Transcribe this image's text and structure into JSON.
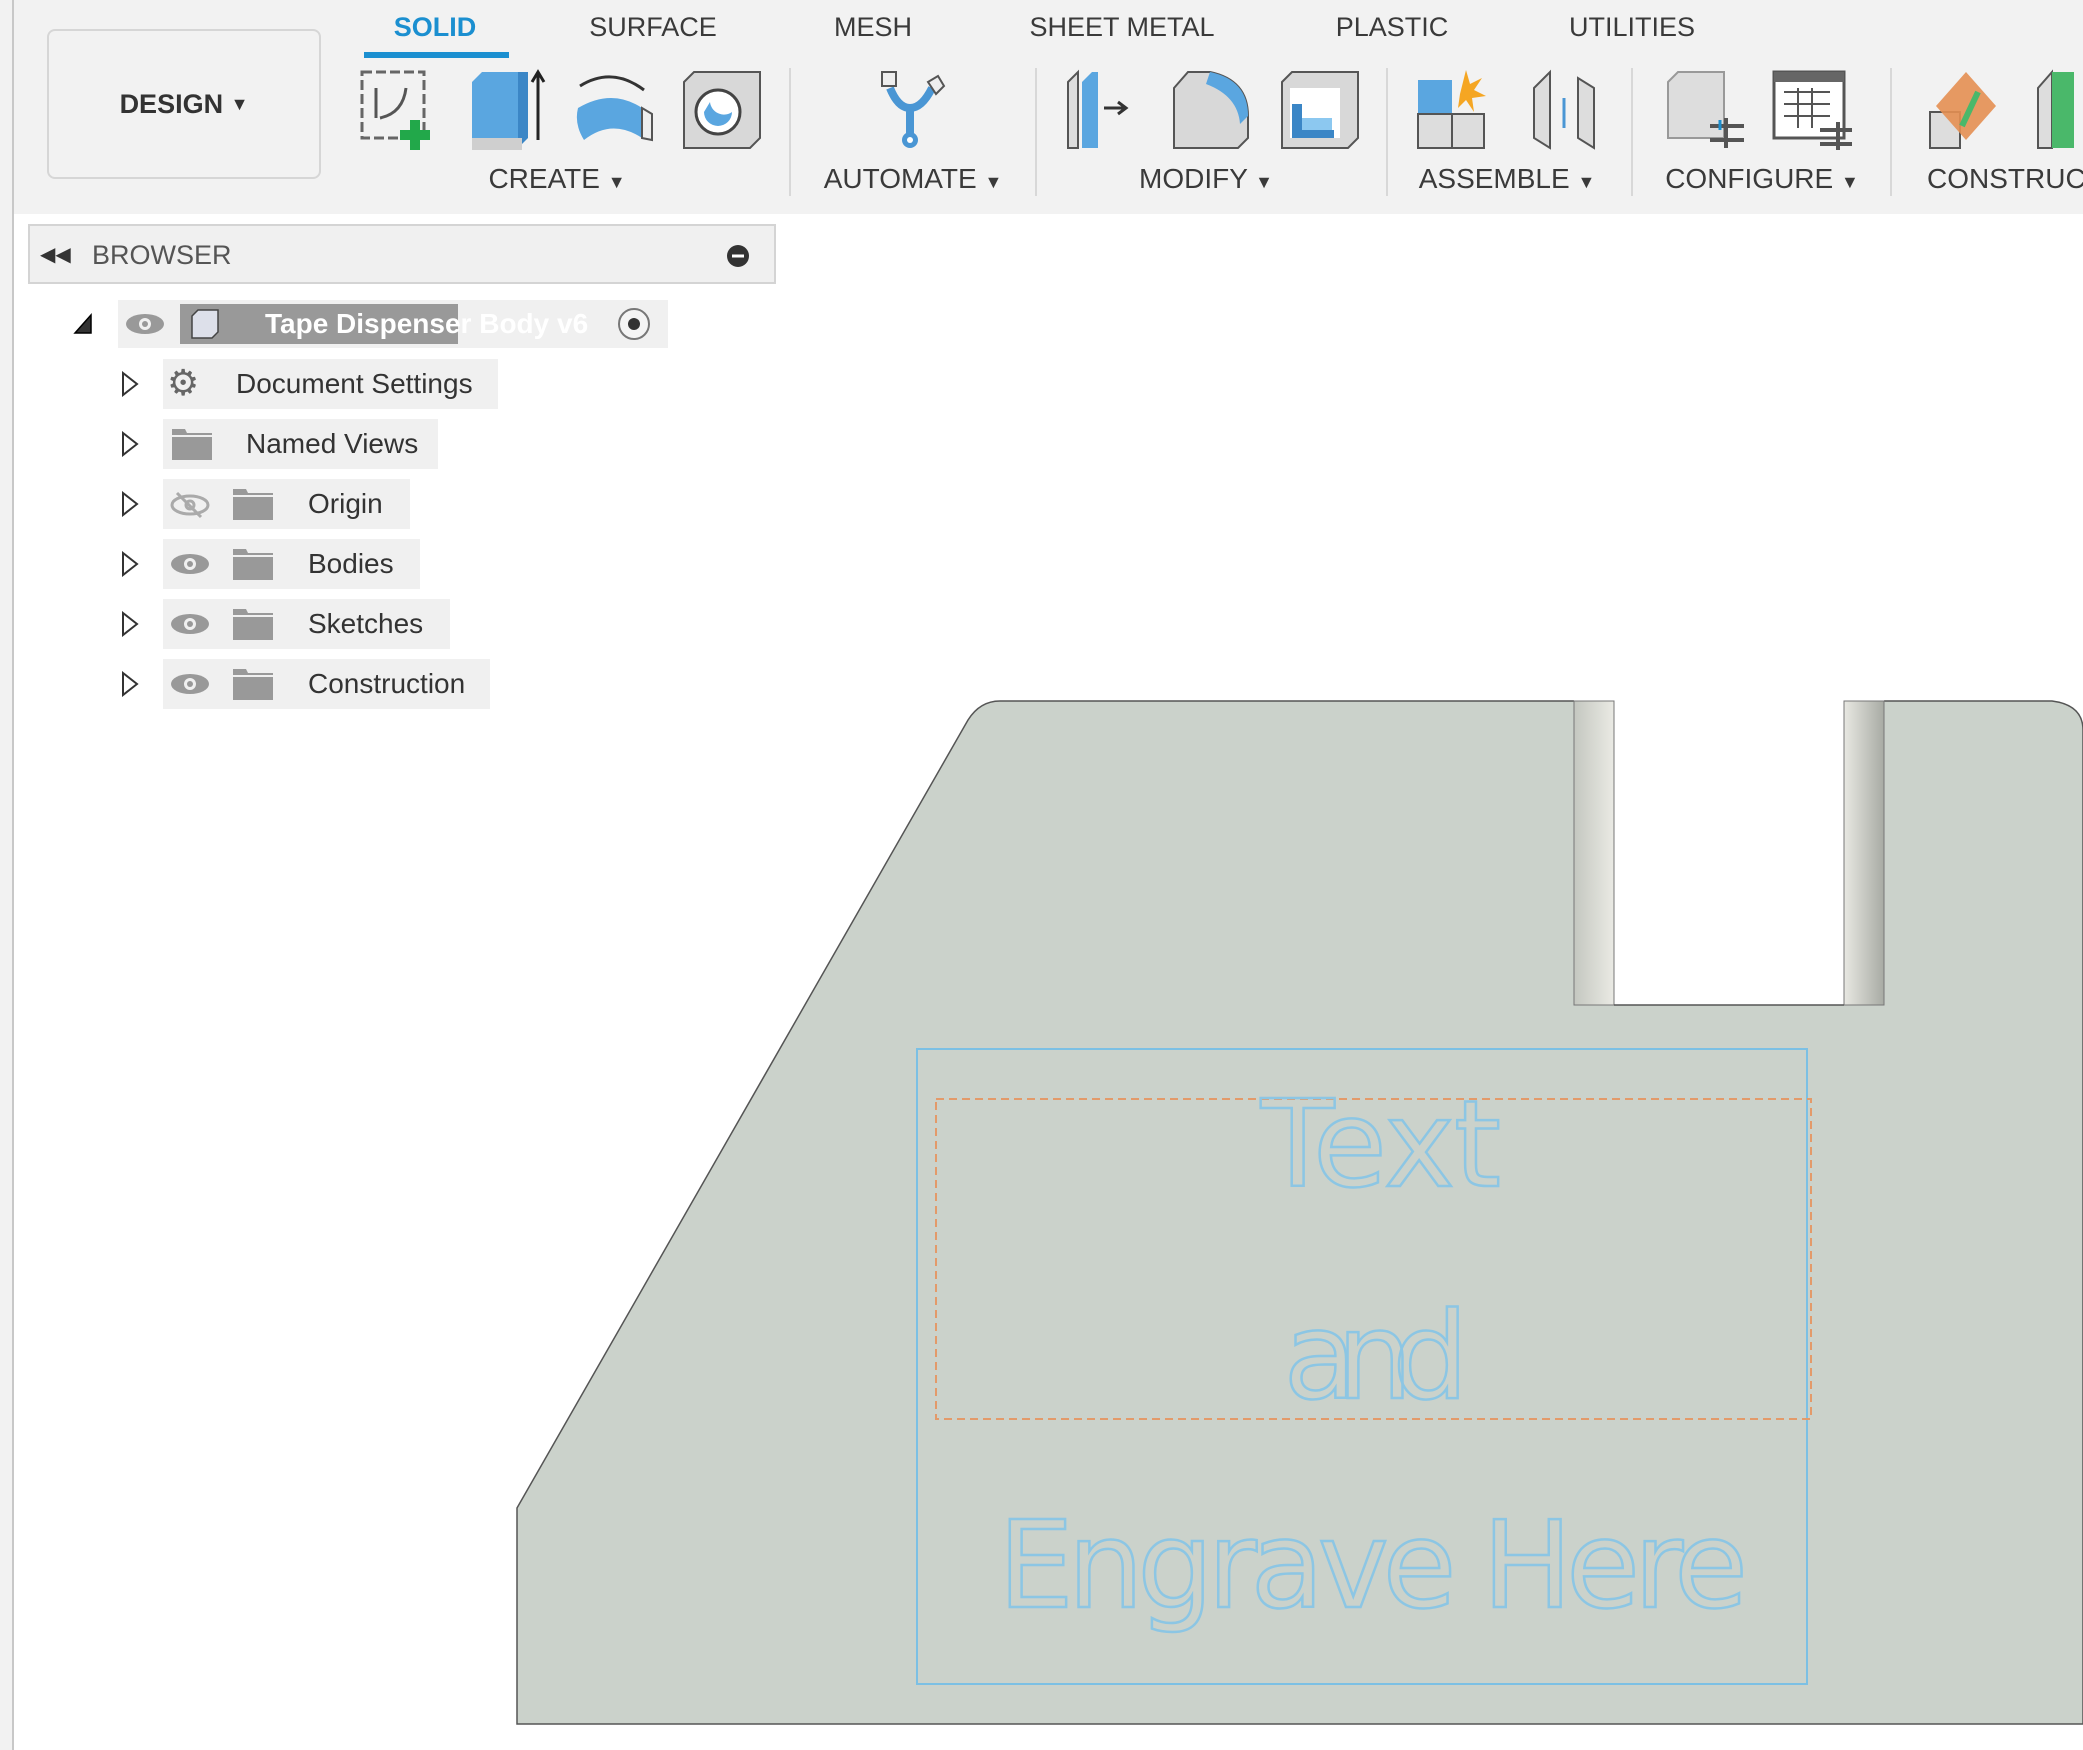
{
  "workspace": {
    "label": "DESIGN"
  },
  "tabs": [
    {
      "label": "SOLID",
      "active": true
    },
    {
      "label": "SURFACE"
    },
    {
      "label": "MESH"
    },
    {
      "label": "SHEET METAL"
    },
    {
      "label": "PLASTIC"
    },
    {
      "label": "UTILITIES"
    }
  ],
  "groups": {
    "create": "CREATE",
    "automate": "AUTOMATE",
    "modify": "MODIFY",
    "assemble": "ASSEMBLE",
    "configure": "CONFIGURE",
    "construct": "CONSTRUC"
  },
  "browser": {
    "title": "BROWSER",
    "root": "Tape Dispenser Body v6",
    "items": [
      {
        "label": "Document Settings",
        "icon": "gear-icon"
      },
      {
        "label": "Named Views",
        "icon": "folder-icon"
      },
      {
        "label": "Origin",
        "icon": "folder-icon",
        "visible": false
      },
      {
        "label": "Bodies",
        "icon": "folder-icon",
        "visible": true
      },
      {
        "label": "Sketches",
        "icon": "folder-icon",
        "visible": true
      },
      {
        "label": "Construction",
        "icon": "folder-icon",
        "visible": true
      }
    ]
  },
  "sketch": {
    "line1": "Text",
    "line2": "and",
    "line3": "Engrave Here"
  },
  "colors": {
    "accent": "#1b8fd0",
    "body": "#cbd2cb",
    "sketch_text": "#8cc6e4",
    "sketch_box": "#7cc0e4",
    "dashed_box": "#e39a6a"
  }
}
